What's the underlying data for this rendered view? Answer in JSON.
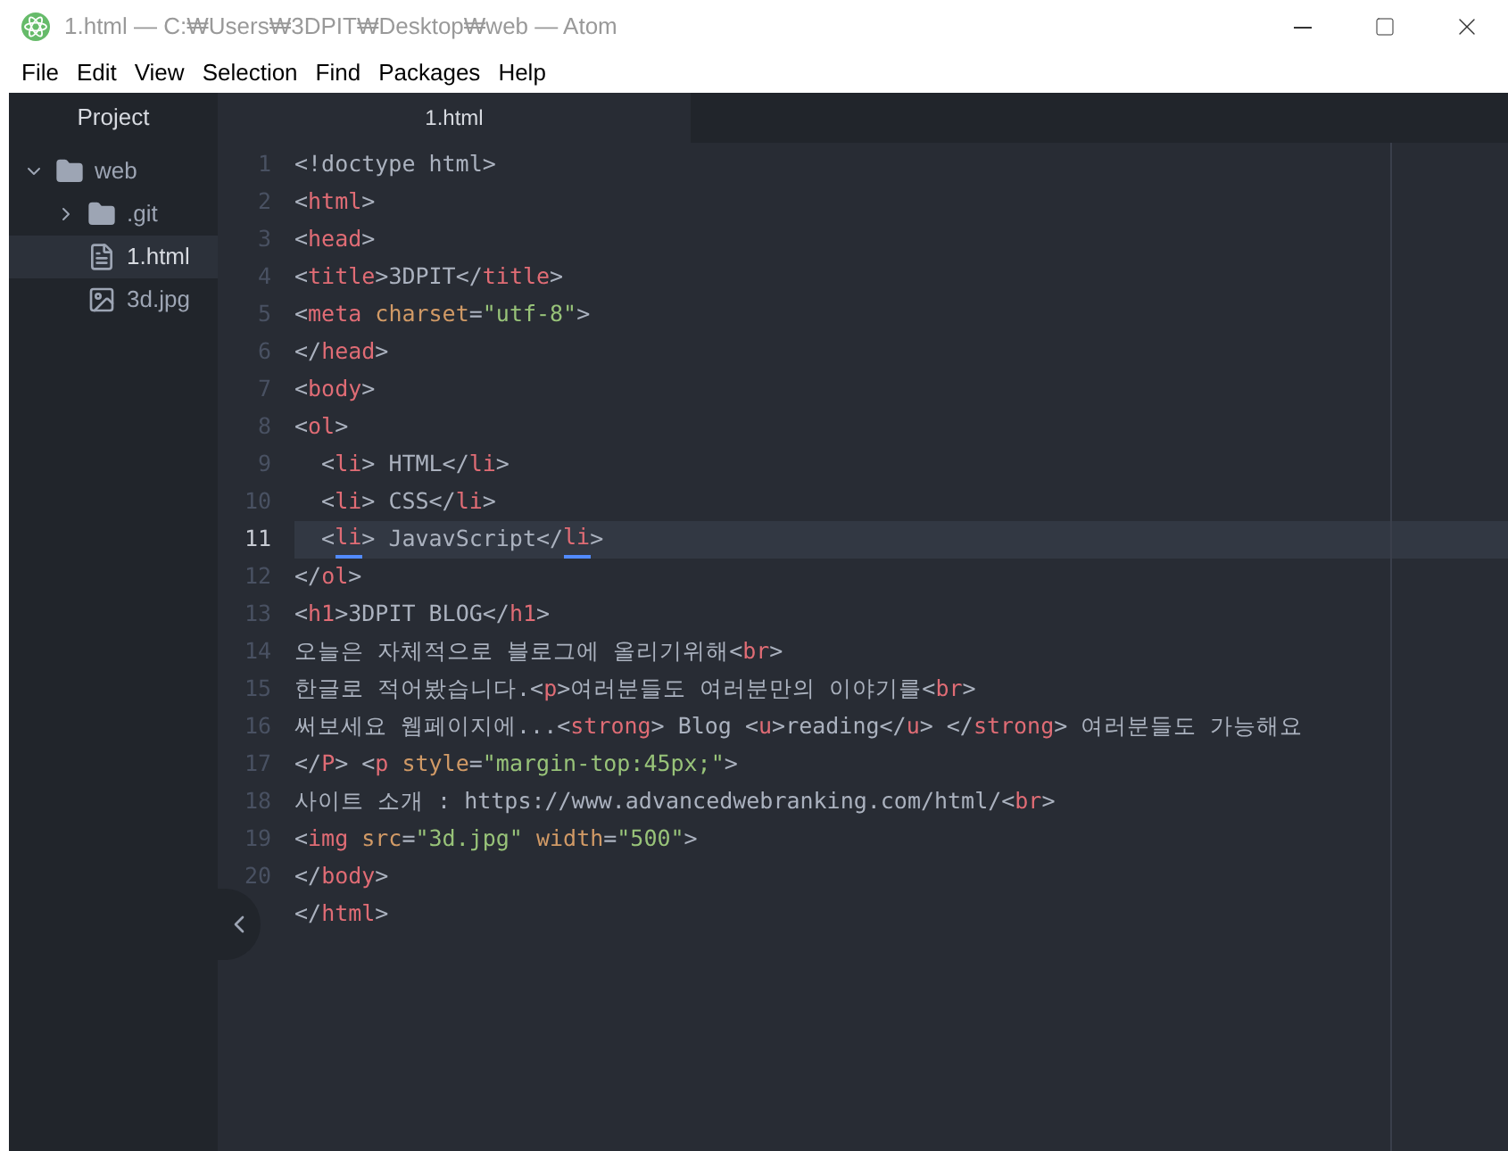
{
  "window": {
    "title": "1.html — C:₩Users₩3DPIT₩Desktop₩web — Atom"
  },
  "menu": [
    "File",
    "Edit",
    "View",
    "Selection",
    "Find",
    "Packages",
    "Help"
  ],
  "sidebar": {
    "title": "Project",
    "tree": [
      {
        "name": "web",
        "kind": "folder",
        "expanded": true,
        "selected": false,
        "children": [
          {
            "name": ".git",
            "kind": "folder",
            "expanded": false,
            "selected": false
          },
          {
            "name": "1.html",
            "kind": "file",
            "selected": true
          },
          {
            "name": "3d.jpg",
            "kind": "image",
            "selected": false
          }
        ]
      }
    ]
  },
  "tabs": [
    {
      "label": "1.html",
      "selected": true
    }
  ],
  "editor": {
    "lines": [
      {
        "number": "1",
        "current": false,
        "tokens": [
          {
            "kind": "plain",
            "text": "<!doctype html>"
          }
        ]
      },
      {
        "number": "2",
        "current": false,
        "tokens": [
          {
            "kind": "plain",
            "text": "<"
          },
          {
            "kind": "tag",
            "text": "html"
          },
          {
            "kind": "plain",
            "text": ">"
          }
        ]
      },
      {
        "number": "3",
        "current": false,
        "tokens": [
          {
            "kind": "plain",
            "text": "<"
          },
          {
            "kind": "tag",
            "text": "head"
          },
          {
            "kind": "plain",
            "text": ">"
          }
        ]
      },
      {
        "number": "4",
        "current": false,
        "tokens": [
          {
            "kind": "plain",
            "text": "<"
          },
          {
            "kind": "tag",
            "text": "title"
          },
          {
            "kind": "plain",
            "text": ">3DPIT</"
          },
          {
            "kind": "tag",
            "text": "title"
          },
          {
            "kind": "plain",
            "text": ">"
          }
        ]
      },
      {
        "number": "5",
        "current": false,
        "tokens": [
          {
            "kind": "plain",
            "text": "<"
          },
          {
            "kind": "tag",
            "text": "meta"
          },
          {
            "kind": "attr",
            "text": " charset"
          },
          {
            "kind": "plain",
            "text": "="
          },
          {
            "kind": "string",
            "text": "\"utf-8\""
          },
          {
            "kind": "plain",
            "text": ">"
          }
        ]
      },
      {
        "number": "6",
        "current": false,
        "tokens": [
          {
            "kind": "plain",
            "text": "</"
          },
          {
            "kind": "tag",
            "text": "head"
          },
          {
            "kind": "plain",
            "text": ">"
          }
        ]
      },
      {
        "number": "7",
        "current": false,
        "tokens": [
          {
            "kind": "plain",
            "text": "<"
          },
          {
            "kind": "tag",
            "text": "body"
          },
          {
            "kind": "plain",
            "text": ">"
          }
        ]
      },
      {
        "number": "8",
        "current": false,
        "tokens": [
          {
            "kind": "plain",
            "text": "<"
          },
          {
            "kind": "tag",
            "text": "ol"
          },
          {
            "kind": "plain",
            "text": ">"
          }
        ]
      },
      {
        "number": "9",
        "current": false,
        "tokens": [
          {
            "kind": "plain",
            "text": "  <"
          },
          {
            "kind": "tag",
            "text": "li"
          },
          {
            "kind": "plain",
            "text": "> HTML</"
          },
          {
            "kind": "tag",
            "text": "li"
          },
          {
            "kind": "plain",
            "text": ">"
          }
        ]
      },
      {
        "number": "10",
        "current": false,
        "tokens": [
          {
            "kind": "plain",
            "text": "  <"
          },
          {
            "kind": "tag",
            "text": "li"
          },
          {
            "kind": "plain",
            "text": "> CSS</"
          },
          {
            "kind": "tag",
            "text": "li"
          },
          {
            "kind": "plain",
            "text": ">"
          }
        ]
      },
      {
        "number": "11",
        "current": true,
        "tokens": [
          {
            "kind": "plain",
            "text": "  <"
          },
          {
            "kind": "matched",
            "text": "li"
          },
          {
            "kind": "plain",
            "text": "> JavavScript</"
          },
          {
            "kind": "matched",
            "text": "li"
          },
          {
            "kind": "plain",
            "text": ">"
          }
        ]
      },
      {
        "number": "12",
        "current": false,
        "tokens": [
          {
            "kind": "plain",
            "text": "</"
          },
          {
            "kind": "tag",
            "text": "ol"
          },
          {
            "kind": "plain",
            "text": ">"
          }
        ]
      },
      {
        "number": "13",
        "current": false,
        "tokens": [
          {
            "kind": "plain",
            "text": "<"
          },
          {
            "kind": "tag",
            "text": "h1"
          },
          {
            "kind": "plain",
            "text": ">3DPIT BLOG</"
          },
          {
            "kind": "tag",
            "text": "h1"
          },
          {
            "kind": "plain",
            "text": ">"
          }
        ]
      },
      {
        "number": "14",
        "current": false,
        "tokens": [
          {
            "kind": "plain",
            "text": "오늘은 자체적으로 블로그에 올리기위해<"
          },
          {
            "kind": "tag",
            "text": "br"
          },
          {
            "kind": "plain",
            "text": ">"
          }
        ]
      },
      {
        "number": "15",
        "current": false,
        "tokens": [
          {
            "kind": "plain",
            "text": "한글로 적어봤습니다.<"
          },
          {
            "kind": "tag",
            "text": "p"
          },
          {
            "kind": "plain",
            "text": ">여러분들도 여러분만의 이야기를<"
          },
          {
            "kind": "tag",
            "text": "br"
          },
          {
            "kind": "plain",
            "text": ">"
          }
        ]
      },
      {
        "number": "16",
        "current": false,
        "tokens": [
          {
            "kind": "plain",
            "text": "써보세요 웹페이지에...<"
          },
          {
            "kind": "tag",
            "text": "strong"
          },
          {
            "kind": "plain",
            "text": "> Blog <"
          },
          {
            "kind": "tag",
            "text": "u"
          },
          {
            "kind": "plain",
            "text": ">reading</"
          },
          {
            "kind": "tag",
            "text": "u"
          },
          {
            "kind": "plain",
            "text": "> </"
          },
          {
            "kind": "tag",
            "text": "strong"
          },
          {
            "kind": "plain",
            "text": "> 여러분들도 가능해요"
          }
        ]
      },
      {
        "number": "17",
        "current": false,
        "tokens": [
          {
            "kind": "plain",
            "text": "</"
          },
          {
            "kind": "tag",
            "text": "P"
          },
          {
            "kind": "plain",
            "text": "> <"
          },
          {
            "kind": "tag",
            "text": "p"
          },
          {
            "kind": "attr",
            "text": " style"
          },
          {
            "kind": "plain",
            "text": "="
          },
          {
            "kind": "string",
            "text": "\"margin-top:45px;\""
          },
          {
            "kind": "plain",
            "text": ">"
          }
        ]
      },
      {
        "number": "18",
        "current": false,
        "tokens": [
          {
            "kind": "plain",
            "text": "사이트 소개 : https://www.advancedwebranking.com/html/<"
          },
          {
            "kind": "tag",
            "text": "br"
          },
          {
            "kind": "plain",
            "text": ">"
          }
        ]
      },
      {
        "number": "19",
        "current": false,
        "tokens": [
          {
            "kind": "plain",
            "text": "<"
          },
          {
            "kind": "tag",
            "text": "img"
          },
          {
            "kind": "attr",
            "text": " src"
          },
          {
            "kind": "plain",
            "text": "="
          },
          {
            "kind": "string",
            "text": "\"3d.jpg\""
          },
          {
            "kind": "attr",
            "text": " width"
          },
          {
            "kind": "plain",
            "text": "="
          },
          {
            "kind": "string",
            "text": "\"500\""
          },
          {
            "kind": "plain",
            "text": ">"
          }
        ]
      },
      {
        "number": "20",
        "current": false,
        "tokens": [
          {
            "kind": "plain",
            "text": "</"
          },
          {
            "kind": "tag",
            "text": "body"
          },
          {
            "kind": "plain",
            "text": ">"
          }
        ]
      },
      {
        "current": false,
        "tokens": [
          {
            "kind": "plain",
            "text": "</"
          },
          {
            "kind": "tag",
            "text": "html"
          },
          {
            "kind": "plain",
            "text": ">"
          }
        ]
      }
    ]
  }
}
